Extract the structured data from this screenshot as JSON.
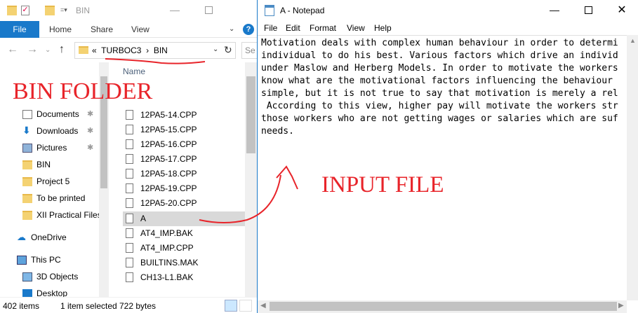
{
  "explorer": {
    "title": "BIN",
    "ribbon": {
      "file": "File",
      "home": "Home",
      "share": "Share",
      "view": "View"
    },
    "address": {
      "prefix": "«",
      "part1": "TURBOC3",
      "sep": "›",
      "part2": "BIN"
    },
    "search_placeholder": "Se",
    "nav_items": [
      {
        "label": "Documents",
        "icon": "documents-icon",
        "pinned": true
      },
      {
        "label": "Downloads",
        "icon": "downloads-icon",
        "pinned": true
      },
      {
        "label": "Pictures",
        "icon": "pictures-icon",
        "pinned": true
      },
      {
        "label": "BIN",
        "icon": "folder-icon",
        "pinned": false
      },
      {
        "label": "Project 5",
        "icon": "folder-icon",
        "pinned": false
      },
      {
        "label": "To be printed",
        "icon": "folder-icon",
        "pinned": false
      },
      {
        "label": "XII Practical Files",
        "icon": "folder-icon",
        "pinned": false
      },
      {
        "label": "OneDrive",
        "icon": "onedrive-icon",
        "pinned": false
      },
      {
        "label": "This PC",
        "icon": "pc-icon",
        "pinned": false
      },
      {
        "label": "3D Objects",
        "icon": "3d-objects-icon",
        "pinned": false
      },
      {
        "label": "Desktop",
        "icon": "desktop-icon",
        "pinned": false
      }
    ],
    "column_header": "Name",
    "files": [
      "12PA5-14.CPP",
      "12PA5-15.CPP",
      "12PA5-16.CPP",
      "12PA5-17.CPP",
      "12PA5-18.CPP",
      "12PA5-19.CPP",
      "12PA5-20.CPP",
      "A",
      "AT4_IMP.BAK",
      "AT4_IMP.CPP",
      "BUILTINS.MAK",
      "CH13-L1.BAK"
    ],
    "selected_file": "A",
    "status": {
      "count": "402 items",
      "selected": "1 item selected",
      "size": "722 bytes"
    }
  },
  "notepad": {
    "title": "A - Notepad",
    "menu": {
      "file": "File",
      "edit": "Edit",
      "format": "Format",
      "view": "View",
      "help": "Help"
    },
    "text": "Motivation deals with complex human behaviour in order to determi\nindividual to do his best. Various factors which drive an individ\nunder Maslow and Herberg Models. In order to motivate the workers\nknow what are the motivational factors influencing the behaviour \nsimple, but it is not true to say that motivation is merely a rel\n According to this view, higher pay will motivate the workers str\nthose workers who are not getting wages or salaries which are suf\nneeds."
  },
  "annotations": {
    "bin_label": "BIN FOLDER",
    "input_label": "INPUT FILE",
    "color": "#e8242a"
  }
}
